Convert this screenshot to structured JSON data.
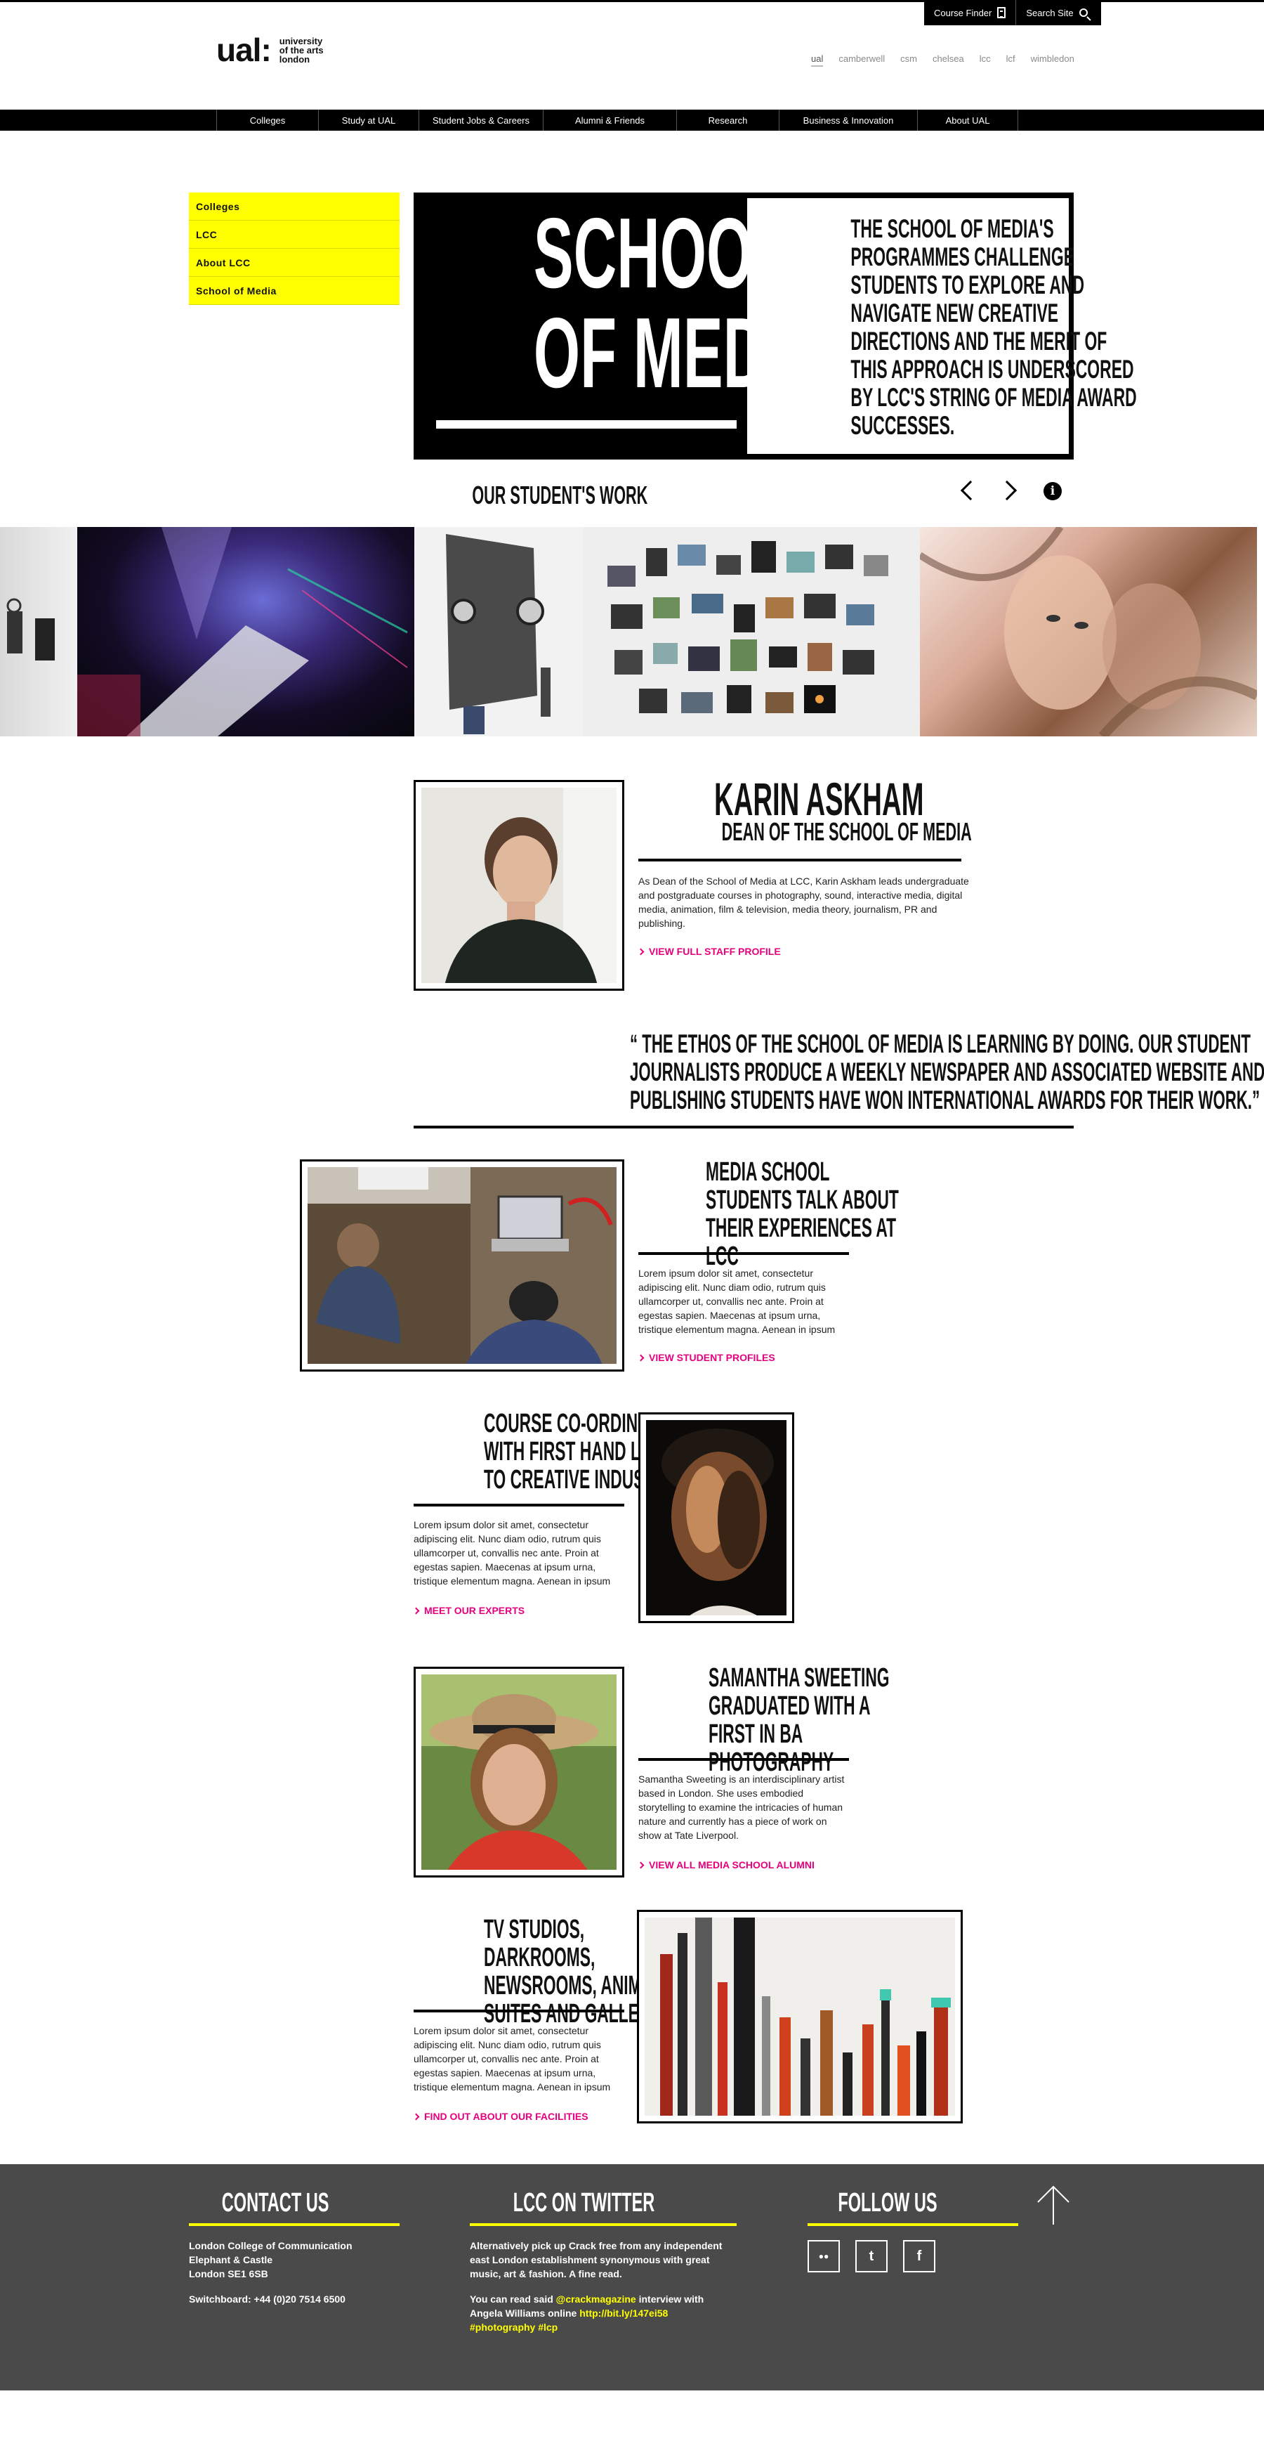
{
  "utility": {
    "course_finder": "Course Finder",
    "search": "Search Site"
  },
  "logo": {
    "mark": "ual:",
    "line1": "university",
    "line2": "of the arts",
    "line3": "london"
  },
  "colleges": [
    "ual",
    "camberwell",
    "csm",
    "chelsea",
    "lcc",
    "lcf",
    "wimbledon"
  ],
  "nav": [
    "Colleges",
    "Study at UAL",
    "Student Jobs & Careers",
    "Alumni & Friends",
    "Research",
    "Business & Innovation",
    "About UAL"
  ],
  "sidemenu": [
    "Colleges",
    "LCC",
    "About LCC",
    "School of Media"
  ],
  "hero": {
    "title_line1": "SCHOOL",
    "title_line2": "OF MEDIA",
    "description": "THE SCHOOL OF MEDIA'S PROGRAMMES CHALLENGE STUDENTS TO EXPLORE AND NAVIGATE NEW CREATIVE DIRECTIONS AND THE MERIT OF THIS APPROACH IS UNDERSCORED BY LCC'S STRING OF MEDIA AWARD SUCCESSES."
  },
  "work": {
    "title": "OUR STUDENT'S WORK",
    "info": "i"
  },
  "profile": {
    "name": "KARIN ASKHAM",
    "role": "DEAN OF THE SCHOOL OF MEDIA",
    "body": "As Dean of the School of Media at LCC, Karin Askham leads undergraduate and postgraduate courses in photography, sound, interactive media, digital media, animation, film & television, media theory, journalism, PR and publishing.",
    "link": "VIEW FULL STAFF PROFILE"
  },
  "quote": "“ THE ETHOS OF THE SCHOOL OF MEDIA IS LEARNING BY DOING. OUR STUDENT JOURNALISTS PRODUCE A WEEKLY NEWSPAPER AND ASSOCIATED WEBSITE AND OUR PUBLISHING STUDENTS HAVE WON INTERNATIONAL AWARDS FOR THEIR WORK.”",
  "sections": [
    {
      "title": "MEDIA SCHOOL STUDENTS TALK ABOUT THEIR EXPERIENCES AT LCC",
      "body": "Lorem ipsum dolor sit amet, consectetur adipiscing elit. Nunc diam odio, rutrum quis ullamcorper ut, convallis nec ante. Proin at egestas sapien. Maecenas at ipsum urna, tristique elementum magna. Aenean in ipsum",
      "link": "VIEW STUDENT PROFILES"
    },
    {
      "title": "COURSE CO-ORDINATORS WITH FIRST HAND LINKS TO CREATIVE INDUSTRIES",
      "body": "Lorem ipsum dolor sit amet, consectetur adipiscing elit. Nunc diam odio, rutrum quis ullamcorper ut, convallis nec ante. Proin at egestas sapien. Maecenas at ipsum urna, tristique elementum magna. Aenean in ipsum",
      "link": "MEET OUR EXPERTS"
    },
    {
      "title": "SAMANTHA SWEETING GRADUATED WITH A FIRST IN BA PHOTOGRAPHY",
      "body": "Samantha Sweeting is an interdisciplinary artist based in London. She uses embodied storytelling to examine the intricacies of human nature and currently has a piece of work on show at Tate Liverpool.",
      "link": "VIEW ALL MEDIA SCHOOL ALUMNI"
    },
    {
      "title": "TV STUDIOS, DARKROOMS, NEWSROOMS, ANIMATION SUITES AND GALLERYS",
      "body": "Lorem ipsum dolor sit amet, consectetur adipiscing elit. Nunc diam odio, rutrum quis ullamcorper ut, convallis nec ante. Proin at egestas sapien. Maecenas at ipsum urna, tristique elementum magna. Aenean in ipsum",
      "link": "FIND OUT ABOUT OUR FACILITIES"
    }
  ],
  "footer": {
    "contact_title": "CONTACT US",
    "address1": "London College of Communication",
    "address2": "Elephant & Castle",
    "address3": "London SE1 6SB",
    "switchboard": "Switchboard: +44 (0)20 7514 6500",
    "twitter_title": "LCC ON TWITTER",
    "tweet1": "Alternatively pick up Crack free from any independent east London establishment synonymous with great music, art & fashion. A fine read.",
    "tweet2_pre": "You can read said ",
    "tweet2_handle": "@crackmagazine",
    "tweet2_mid": " interview with Angela Williams online ",
    "tweet2_link": "http://bit.ly/147ei58",
    "tweet2_tags": "#photography #lcp",
    "follow_title": "FOLLOW US",
    "social": [
      "flickr-icon",
      "twitter-icon",
      "facebook-icon"
    ],
    "social_glyphs": [
      "●●",
      "t",
      "f"
    ]
  },
  "colors": {
    "accent_yellow": "#ffff00",
    "link_pink": "#e6007e",
    "footer_bg": "#4a4a4a"
  }
}
